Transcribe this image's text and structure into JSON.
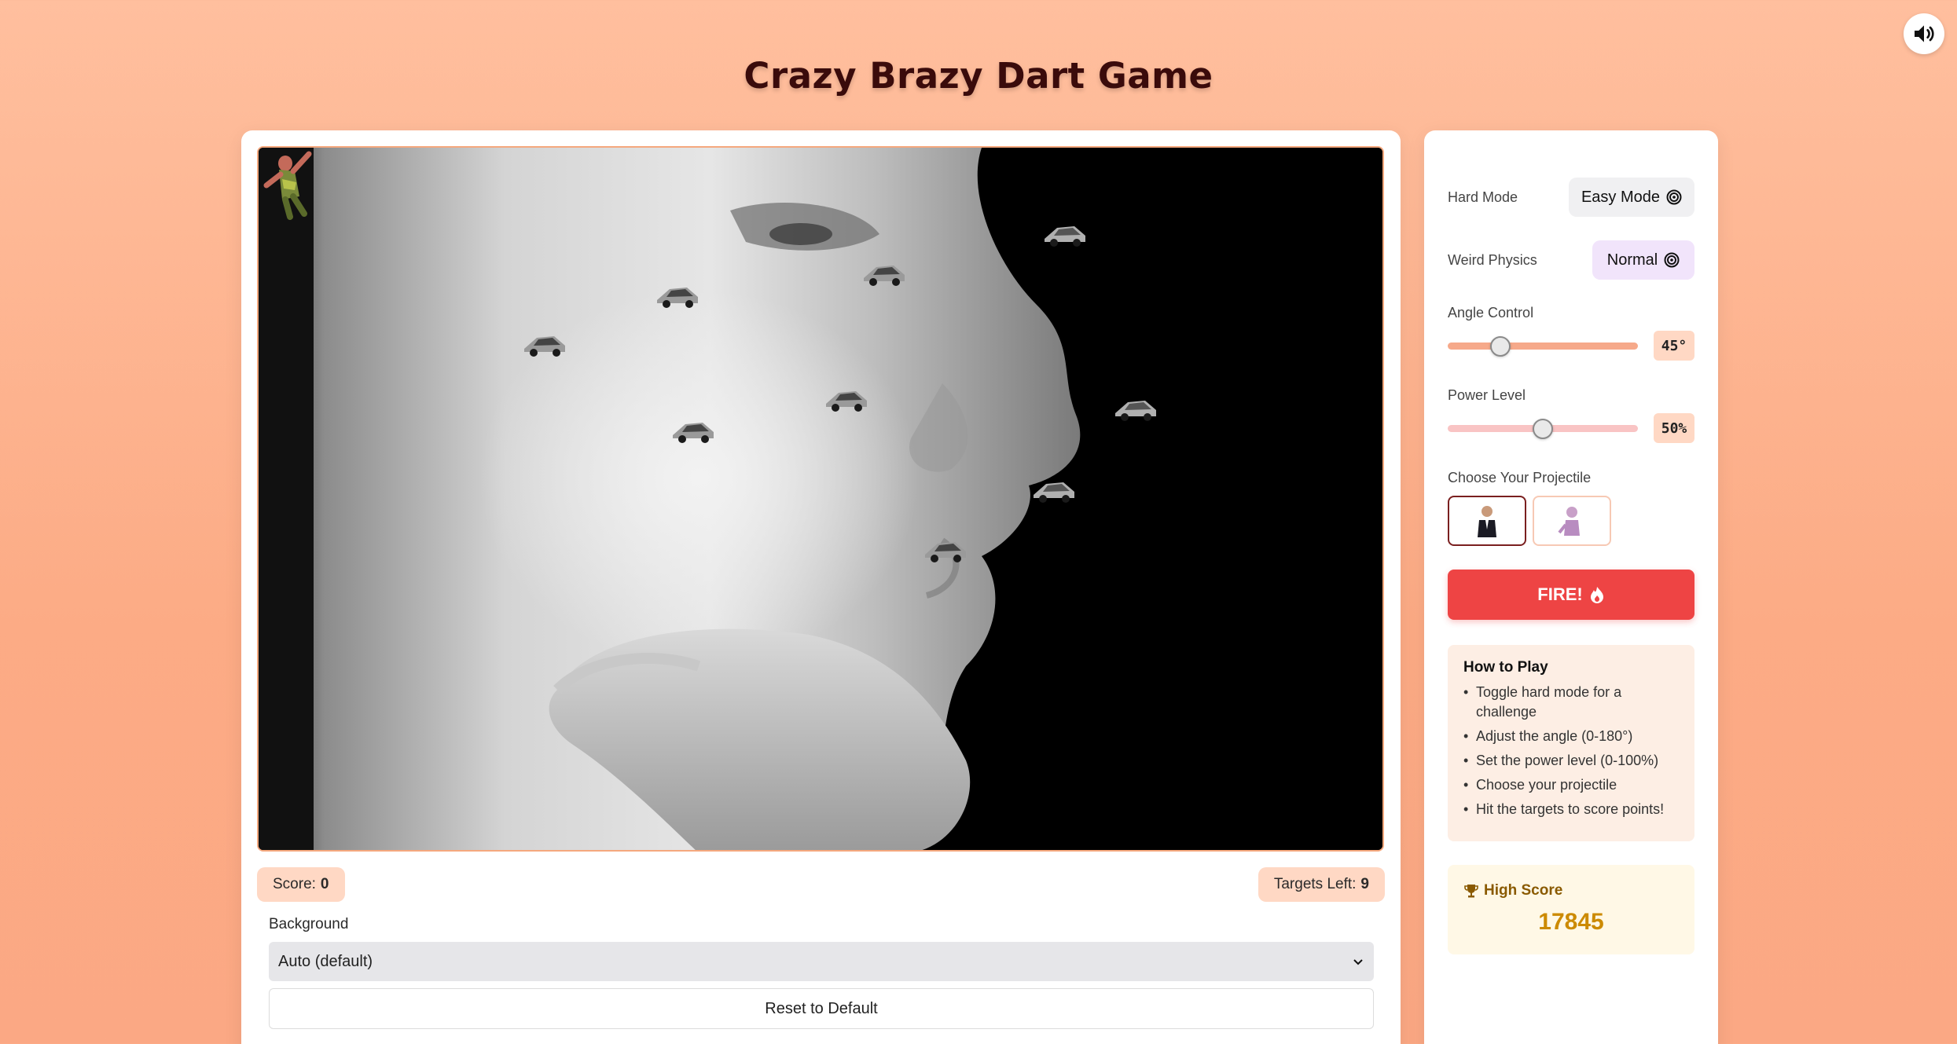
{
  "title": "Crazy Brazy Dart Game",
  "sound_icon": "volume-icon",
  "scoreboard": {
    "score_label": "Score:",
    "score_value": "0",
    "targets_label": "Targets Left:",
    "targets_value": "9"
  },
  "background": {
    "label": "Background",
    "selected": "Auto (default)"
  },
  "reset_label": "Reset to Default",
  "controls": {
    "hard_mode_label": "Hard Mode",
    "hard_mode_value": "Easy Mode",
    "weird_physics_label": "Weird Physics",
    "weird_physics_value": "Normal",
    "angle_label": "Angle Control",
    "angle_value": "45°",
    "angle_fraction": 0.25,
    "power_label": "Power Level",
    "power_value": "50%",
    "power_fraction": 0.5,
    "projectile_label": "Choose Your Projectile",
    "projectiles": [
      "man-in-suit",
      "pink-creature"
    ],
    "selected_projectile": 0,
    "fire_label": "FIRE!"
  },
  "how_to_play": {
    "heading": "How to Play",
    "items": [
      "Toggle hard mode for a challenge",
      "Adjust the angle (0-180°)",
      "Set the power level (0-100%)",
      "Choose your projectile",
      "Hit the targets to score points!"
    ]
  },
  "high_score": {
    "label": "High Score",
    "value": "17845"
  },
  "colors": {
    "accent": "#ee4444",
    "page_bg": "#fcab85",
    "pill_bg": "#ffd8c4"
  }
}
